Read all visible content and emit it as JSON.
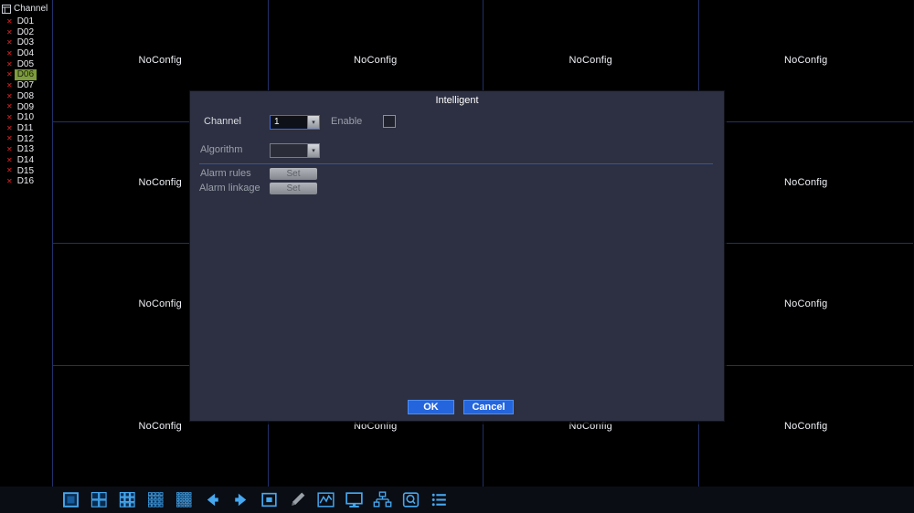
{
  "sidebar": {
    "header": "Channel",
    "selected_channel": "D06",
    "channels": [
      "D01",
      "D02",
      "D03",
      "D04",
      "D05",
      "D06",
      "D07",
      "D08",
      "D09",
      "D10",
      "D11",
      "D12",
      "D13",
      "D14",
      "D15",
      "D16"
    ]
  },
  "grid": {
    "rows": 4,
    "cols": 4,
    "cell_label": "NoConfig"
  },
  "dialog": {
    "title": "Intelligent",
    "channel_label": "Channel",
    "channel_value": "1",
    "enable_label": "Enable",
    "enable_checked": false,
    "algorithm_label": "Algorithm",
    "algorithm_value": "",
    "alarm_rules_label": "Alarm rules",
    "alarm_linkage_label": "Alarm linkage",
    "set_label": "Set",
    "ok_label": "OK",
    "cancel_label": "Cancel"
  },
  "toolbar": {
    "icons": [
      "single-view-icon",
      "quad-view-icon",
      "nine-view-icon",
      "sixteen-view-icon",
      "twentyfive-view-icon",
      "previous-page-icon",
      "next-page-icon",
      "fullscreen-icon",
      "color-brush-icon",
      "wave-chart-icon",
      "monitor-icon",
      "network-icon",
      "record-icon",
      "channel-list-icon"
    ]
  },
  "colors": {
    "accent_blue": "#2465dd",
    "grid_line": "#223069",
    "selected_green": "#7d9c3c",
    "icon_blue": "#46a8f0",
    "offline_red": "#e02424"
  }
}
